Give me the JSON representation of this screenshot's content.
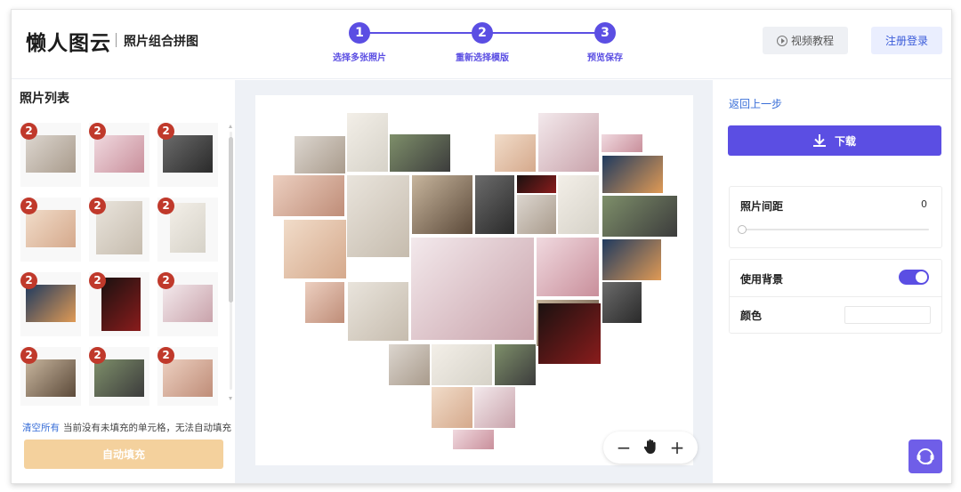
{
  "header": {
    "logo": "懒人图云",
    "subtitle": "照片组合拼图",
    "steps": [
      {
        "number": "1",
        "label": "选择多张照片"
      },
      {
        "number": "2",
        "label": "重新选择模版"
      },
      {
        "number": "3",
        "label": "预览保存"
      }
    ],
    "video_button": "视频教程",
    "login_button": "注册登录"
  },
  "left": {
    "title": "照片列表",
    "badge_count": "2",
    "clear_all": "清空所有",
    "hint": "当前没有未填充的单元格，无法自动填充",
    "auto_fill_button": "自动填充"
  },
  "center": {
    "zoom_out": "−",
    "pan_icon": "hand-icon",
    "zoom_in": "+"
  },
  "right": {
    "back_link": "返回上一步",
    "download_button": "下载",
    "spacing_label": "照片间距",
    "spacing_value": "0",
    "spacing_level": 0,
    "background_label": "使用背景",
    "background_enabled": true,
    "color_label": "颜色"
  },
  "colors": {
    "accent": "#5b4ee3",
    "badge": "#c0392b",
    "auto_fill_disabled": "#f4d19d",
    "link": "#3a6fd8"
  }
}
